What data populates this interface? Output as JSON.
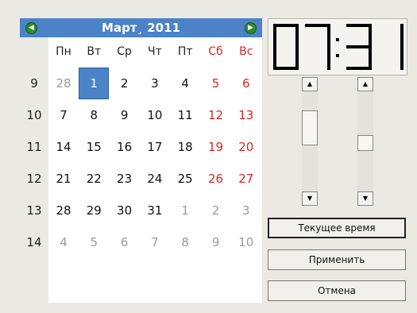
{
  "calendar": {
    "title": "Март¸ 2011",
    "nav_prev": "◀",
    "nav_next": "▶",
    "weekdays": [
      "Пн",
      "Вт",
      "Ср",
      "Чт",
      "Пт",
      "Сб",
      "Вс"
    ],
    "weeks": [
      "9",
      "10",
      "11",
      "12",
      "13",
      "14"
    ],
    "rows": [
      [
        "28",
        "1",
        "2",
        "3",
        "4",
        "5",
        "6"
      ],
      [
        "7",
        "8",
        "9",
        "10",
        "11",
        "12",
        "13"
      ],
      [
        "14",
        "15",
        "16",
        "17",
        "18",
        "19",
        "20"
      ],
      [
        "21",
        "22",
        "23",
        "24",
        "25",
        "26",
        "27"
      ],
      [
        "28",
        "29",
        "30",
        "31",
        "1",
        "2",
        "3"
      ],
      [
        "4",
        "5",
        "6",
        "7",
        "8",
        "9",
        "10"
      ]
    ],
    "selected_day": "1",
    "colors": {
      "accent": "#4b82c8",
      "weekend": "#e02424",
      "other_month": "#9a9a9a"
    }
  },
  "clock": {
    "time": "07:31",
    "hours": "07",
    "minutes": "31"
  },
  "scrollbars": {
    "hours_level": 0.29,
    "minutes_level": 0.52,
    "up_icon": "arrow-up-icon",
    "down_icon": "arrow-down-icon"
  },
  "buttons": {
    "current_time": "Текущее время",
    "apply": "Применить",
    "cancel": "Отмена"
  }
}
